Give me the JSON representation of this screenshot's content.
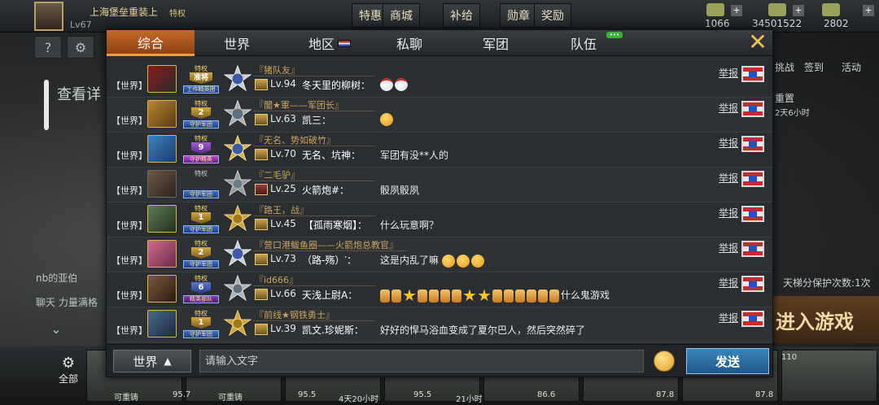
{
  "background": {
    "player_name": "上海堡垒重装上",
    "player_level": "Lv67",
    "privilege": "特权",
    "top_buttons": [
      "特惠",
      "商城",
      "补给",
      "勋章",
      "奖励"
    ],
    "resources": [
      "1066",
      "34501522",
      "2802"
    ],
    "detail_text": "查看详",
    "left_chat_lines": [
      "nb的亚伯",
      "力量满格"
    ],
    "left_chat_label": "聊天",
    "right_labels": [
      "挑战",
      "签到",
      "活动",
      "重置",
      "2天6小时"
    ],
    "protect_text": "天梯分保护次数:1次",
    "enter_game": "进入游戏",
    "all_label": "全部",
    "bottom_values": [
      "95.7",
      "95.5",
      "4天20小时",
      "95.5",
      "21小时",
      "86.6",
      "87.8",
      "87.8"
    ],
    "bottom_tags": [
      "可重铸",
      "可重铸",
      "110"
    ]
  },
  "tabs": [
    {
      "label": "综合",
      "active": true
    },
    {
      "label": "世界",
      "active": false
    },
    {
      "label": "地区",
      "active": false
    },
    {
      "label": "私聊",
      "active": false
    },
    {
      "label": "军团",
      "active": false
    },
    {
      "label": "队伍",
      "active": false
    }
  ],
  "report_label": "举报",
  "messages": [
    {
      "channel": "【世界】",
      "guild": "『猪队友』",
      "level": "Lv.94",
      "sender": "冬天里的柳树：",
      "badge_top": "特权",
      "badge_mid": "准将",
      "badge_bottom": "工作精英团",
      "text": ""
    },
    {
      "channel": "【世界】",
      "guild": "『闇★軍——军团长』",
      "level": "Lv.63",
      "sender": "凯三：",
      "badge_top": "特权",
      "badge_mid": "2",
      "badge_bottom": "守护军团",
      "text": ""
    },
    {
      "channel": "【世界】",
      "guild": "『无名、势如破竹』",
      "level": "Lv.70",
      "sender": "无名、坑神：",
      "badge_top": "特权",
      "badge_mid": "9",
      "badge_bottom": "守护精英",
      "text": "军团有没**人的"
    },
    {
      "channel": "【世界】",
      "guild": "『二毛驴』",
      "level": "Lv.25",
      "sender": "火箭炮#：",
      "badge_top": "特权",
      "badge_mid": "",
      "badge_bottom": "守护军团",
      "text": "骰夙骰夙"
    },
    {
      "channel": "【世界】",
      "guild": "『路王，战』",
      "level": "Lv.45",
      "sender": "【孤雨寒烟】：",
      "badge_top": "特权",
      "badge_mid": "1",
      "badge_bottom": "守护军团",
      "text": "什么玩意啊？"
    },
    {
      "channel": "【世界】",
      "guild": "『营口港鲅鱼圈——火箭炮总教官』",
      "level": "Lv.73",
      "sender": "（路-殇）′：",
      "badge_top": "特权",
      "badge_mid": "2",
      "badge_bottom": "守护军团",
      "text": "这是内乱了嘛"
    },
    {
      "channel": "【世界】",
      "guild": "『id666』",
      "level": "Lv.66",
      "sender": "天浅上尉A：",
      "badge_top": "特权",
      "badge_mid": "6",
      "badge_bottom": "精英部队",
      "text": "什么鬼游戏"
    },
    {
      "channel": "【世界】",
      "guild": "『前线★钢铁勇士』",
      "level": "Lv.39",
      "sender": "凯文.珍妮斯：",
      "badge_top": "特权",
      "badge_mid": "1",
      "badge_bottom": "守护军团",
      "text": "好好的悍马浴血变成了夏尔巴人，然后突然碎了"
    }
  ],
  "input": {
    "channel": "世界",
    "placeholder": "请输入文字",
    "send_label": "发送"
  },
  "colors": {
    "active_tab": "#c7692a",
    "send_button": "#2a70a6",
    "guild_text": "#c9a45e"
  }
}
